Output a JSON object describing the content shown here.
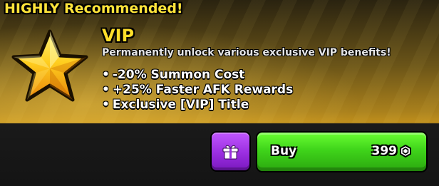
{
  "banner": {
    "text": "HIGHLY Recommended!"
  },
  "offer": {
    "title": "VIP",
    "subtitle": "Permanently unlock various exclusive VIP benefits!",
    "benefits": [
      "-20% Summon Cost",
      "+25% Faster AFK Rewards",
      "Exclusive [VIP] Title"
    ],
    "bullet": "•",
    "icon": "star-icon"
  },
  "actions": {
    "gift_icon": "gift-icon",
    "buy_label": "Buy",
    "price": "399",
    "currency_icon": "robux-icon"
  },
  "colors": {
    "banner_text": "#ffe43a",
    "title": "#ffde2a",
    "gift_button": "#a43be8",
    "buy_button": "#3fd41a"
  }
}
